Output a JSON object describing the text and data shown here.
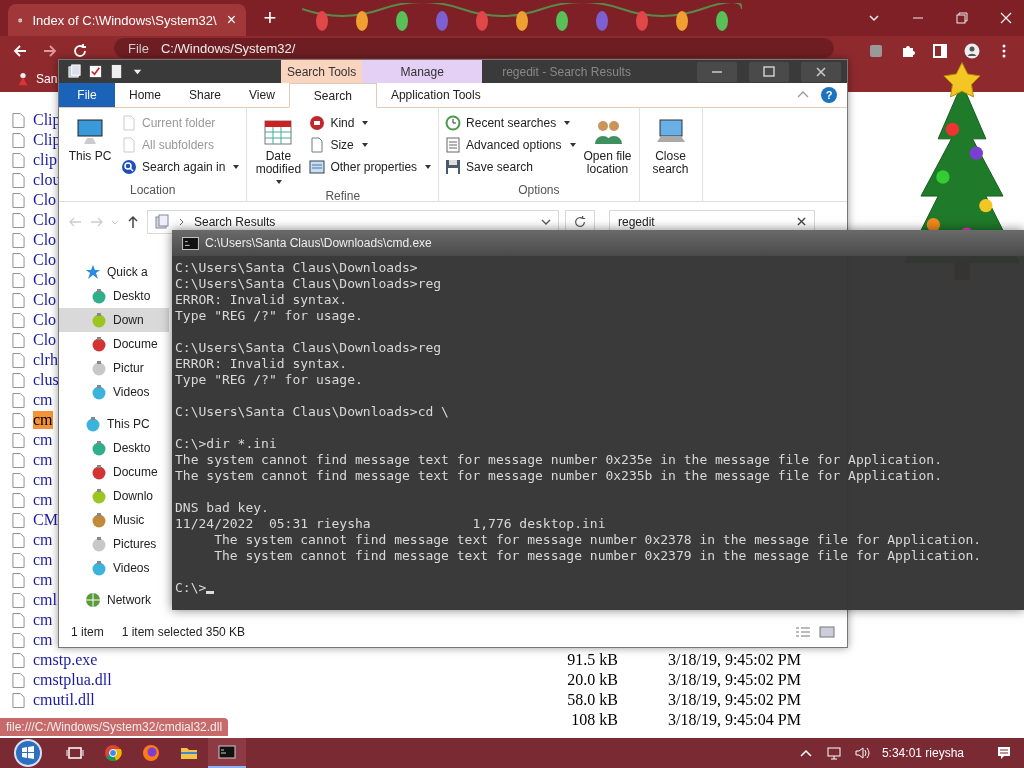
{
  "browser": {
    "tab": {
      "title": "Index of C:\\Windows\\System32\\",
      "close": "×"
    },
    "new_tab": "+",
    "address": {
      "scheme": "File",
      "path": "C:/Windows/System32/"
    },
    "bookmark": "San"
  },
  "listing": {
    "fragments": [
      {
        "text": "Clip",
        "highlighted": false
      },
      {
        "text": "Clip",
        "highlighted": false
      },
      {
        "text": "clip",
        "highlighted": false
      },
      {
        "text": "clou",
        "highlighted": false
      },
      {
        "text": "Clo",
        "highlighted": false
      },
      {
        "text": "Clo",
        "highlighted": false
      },
      {
        "text": "Clo",
        "highlighted": false
      },
      {
        "text": "Clo",
        "highlighted": false
      },
      {
        "text": "Clo",
        "highlighted": false
      },
      {
        "text": "Clo",
        "highlighted": false
      },
      {
        "text": "Clo",
        "highlighted": false
      },
      {
        "text": "Clo",
        "highlighted": false
      },
      {
        "text": "clrh",
        "highlighted": false
      },
      {
        "text": "clus",
        "highlighted": false
      },
      {
        "text": "cm",
        "highlighted": false
      },
      {
        "text": "cm",
        "highlighted": true
      },
      {
        "text": "cm",
        "highlighted": false
      },
      {
        "text": "cm",
        "highlighted": false
      },
      {
        "text": "cm",
        "highlighted": false
      },
      {
        "text": "cm",
        "highlighted": false
      },
      {
        "text": "CM",
        "highlighted": false
      },
      {
        "text": "cm",
        "highlighted": false
      },
      {
        "text": "cm",
        "highlighted": false
      },
      {
        "text": "cm",
        "highlighted": false
      },
      {
        "text": "cml",
        "highlighted": false
      },
      {
        "text": "cm",
        "highlighted": false
      },
      {
        "text": "cm",
        "highlighted": false
      }
    ],
    "rows": [
      {
        "name": "cmstp.exe",
        "size": "91.5 kB",
        "date": "3/18/19, 9:45:02 PM"
      },
      {
        "name": "cmstplua.dll",
        "size": "20.0 kB",
        "date": "3/18/19, 9:45:02 PM"
      },
      {
        "name": "cmutil.dll",
        "size": "58.0 kB",
        "date": "3/18/19, 9:45:02 PM"
      },
      {
        "size": "108 kB",
        "date": "3/18/19, 9:45:04 PM"
      }
    ]
  },
  "status_link": "file:///C:/Windows/System32/cmdial32.dll",
  "explorer": {
    "title": "regedit - Search Results",
    "contextual_tabs": [
      {
        "label": "Search Tools",
        "color": "#f9d4be"
      },
      {
        "label": "Manage",
        "color": "#e4d0f5"
      }
    ],
    "file_tab": "File",
    "tabs": [
      {
        "label": "Home",
        "selected": false
      },
      {
        "label": "Share",
        "selected": false
      },
      {
        "label": "View",
        "selected": false
      },
      {
        "label": "Search",
        "selected": true
      },
      {
        "label": "Application Tools",
        "selected": false
      }
    ],
    "groups": [
      {
        "label": "Location",
        "items": [
          {
            "label": "This PC",
            "kind": "large",
            "disabled": false,
            "dropdown": false
          },
          {
            "label": "Current folder",
            "kind": "small",
            "disabled": true,
            "dropdown": false
          },
          {
            "label": "All subfolders",
            "kind": "small",
            "disabled": true,
            "dropdown": false
          },
          {
            "label": "Search again in",
            "kind": "small",
            "disabled": false,
            "dropdown": true
          }
        ]
      },
      {
        "label": "Refine",
        "items": [
          {
            "label": "Date modified",
            "kind": "large",
            "disabled": false,
            "dropdown": true
          },
          {
            "label": "Kind",
            "kind": "small",
            "disabled": false,
            "dropdown": true
          },
          {
            "label": "Size",
            "kind": "small",
            "disabled": false,
            "dropdown": true
          },
          {
            "label": "Other properties",
            "kind": "small",
            "disabled": false,
            "dropdown": true
          }
        ]
      },
      {
        "label": "Options",
        "items": [
          {
            "label": "Recent searches",
            "kind": "small",
            "disabled": false,
            "dropdown": true
          },
          {
            "label": "Advanced options",
            "kind": "small",
            "disabled": false,
            "dropdown": true
          },
          {
            "label": "Save search",
            "kind": "small",
            "disabled": false,
            "dropdown": false
          },
          {
            "label": "Open file location",
            "kind": "large",
            "disabled": false,
            "dropdown": false
          }
        ]
      },
      {
        "items": [
          {
            "label": "Close search",
            "kind": "large",
            "disabled": false,
            "dropdown": false
          }
        ]
      }
    ],
    "help": "?",
    "location": "Search Results",
    "search": {
      "value": "regedit"
    },
    "nav": [
      {
        "label": "Quick a",
        "selected": false,
        "children": [
          {
            "label": "Deskto",
            "selected": false
          },
          {
            "label": "Down",
            "selected": true
          },
          {
            "label": "Docume",
            "selected": false
          },
          {
            "label": "Pictur",
            "selected": false
          },
          {
            "label": "Videos",
            "selected": false
          }
        ]
      },
      {
        "label": "This PC",
        "selected": false,
        "children": [
          {
            "label": "Deskto",
            "selected": false
          },
          {
            "label": "Docume",
            "selected": false
          },
          {
            "label": "Downlo",
            "selected": false
          },
          {
            "label": "Music",
            "selected": false
          },
          {
            "label": "Pictures",
            "selected": false
          },
          {
            "label": "Videos",
            "selected": false
          }
        ]
      },
      {
        "label": "Network",
        "selected": false
      }
    ],
    "status": {
      "count": "1 item",
      "selection": "1 item selected  350 KB"
    }
  },
  "cmd": {
    "title": "C:\\Users\\Santa Claus\\Downloads\\cmd.exe",
    "blocks": [
      [
        "C:\\Users\\Santa Claus\\Downloads>",
        "C:\\Users\\Santa Claus\\Downloads>reg",
        "ERROR: Invalid syntax.",
        "Type \"REG /?\" for usage."
      ],
      [
        "C:\\Users\\Santa Claus\\Downloads>reg",
        "ERROR: Invalid syntax.",
        "Type \"REG /?\" for usage."
      ],
      [
        "C:\\Users\\Santa Claus\\Downloads>cd \\"
      ],
      [
        "C:\\>dir *.ini",
        "The system cannot find message text for message number 0x235e in the message file for Application.",
        "The system cannot find message text for message number 0x235b in the message file for Application."
      ],
      [
        "DNS bad key.",
        "11/24/2022  05:31 rieysha             1,776 desktop.ini",
        "     The system cannot find message text for message number 0x2378 in the message file for Application.",
        "     The system cannot find message text for message number 0x2379 in the message file for Application."
      ]
    ],
    "prompt": "C:\\>"
  },
  "taskbar": {
    "apps": [
      {
        "kind": "taskview",
        "active": false
      },
      {
        "kind": "chrome",
        "active": false
      },
      {
        "kind": "firefox",
        "active": false
      },
      {
        "kind": "explorer",
        "active": false
      },
      {
        "kind": "cmd",
        "active": true
      }
    ],
    "clock": "5:34:01 rieysha"
  }
}
